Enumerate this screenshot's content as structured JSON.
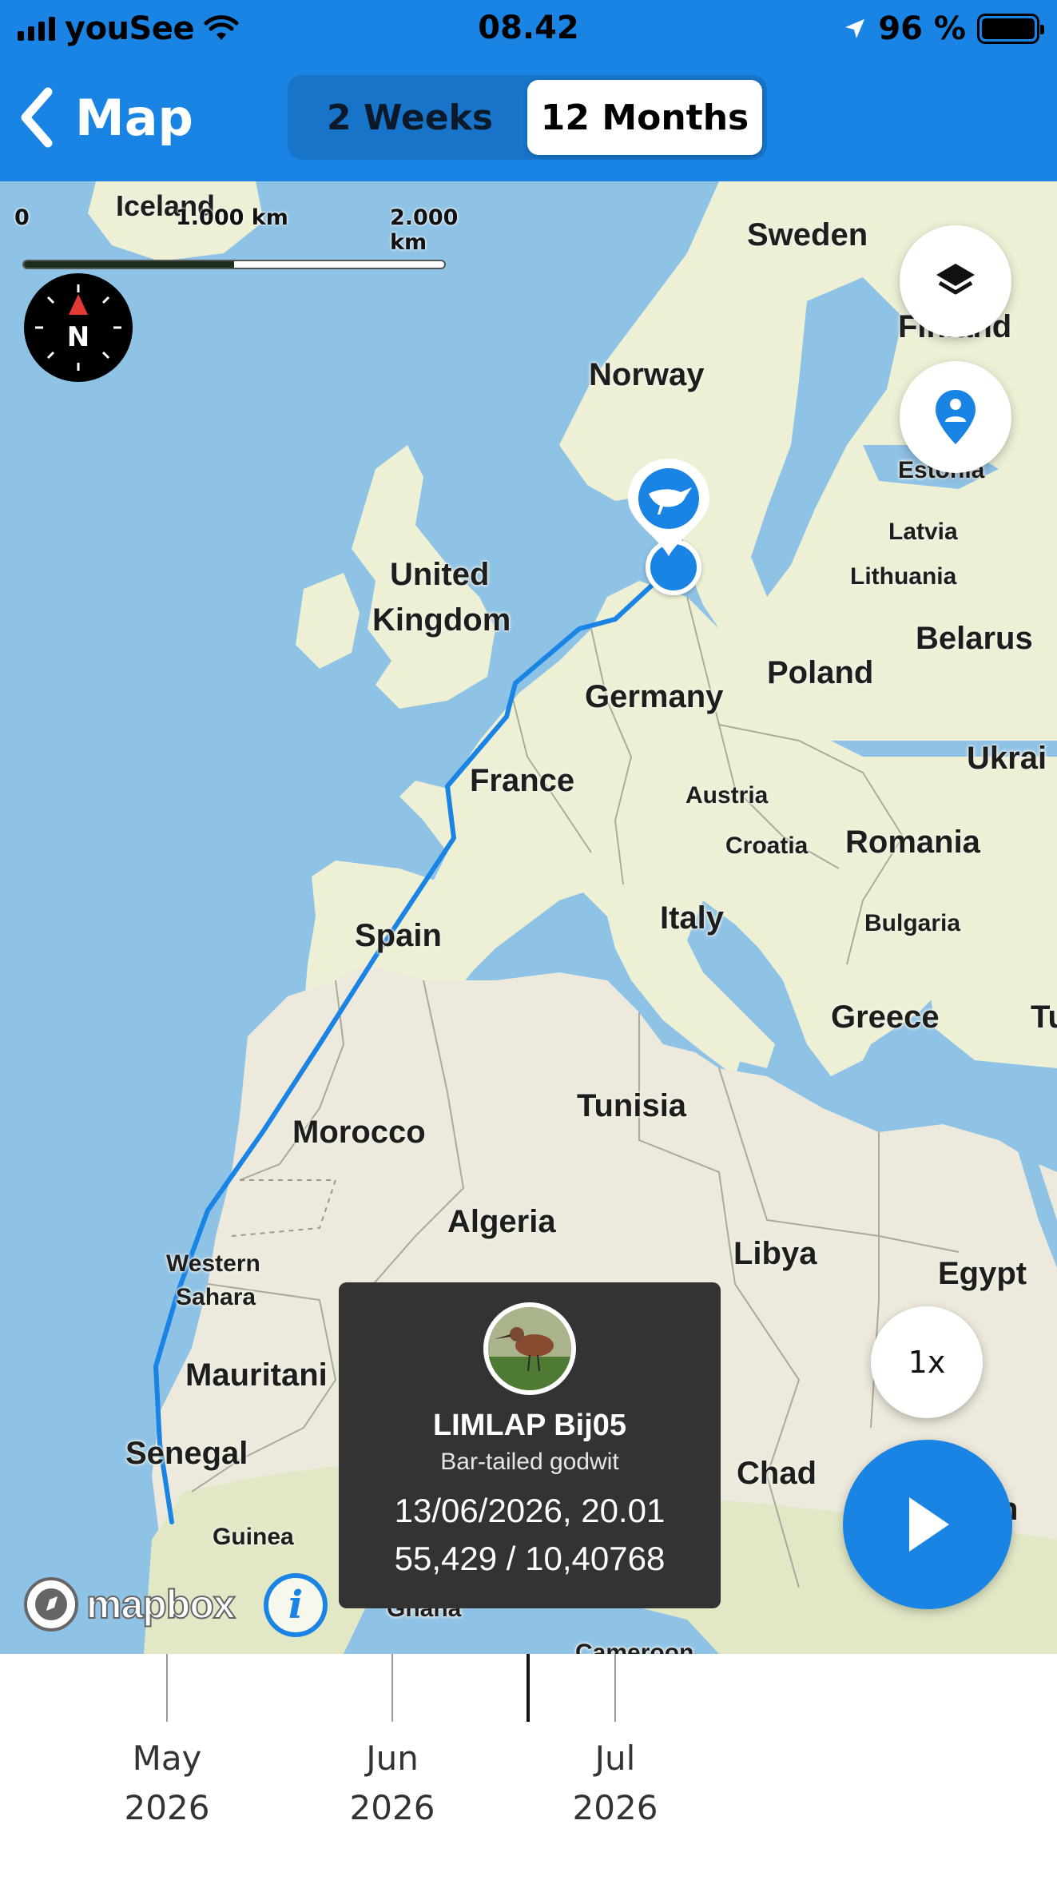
{
  "status_bar": {
    "carrier": "youSee",
    "time": "08.42",
    "battery": "96 %"
  },
  "nav": {
    "back_label": "Map",
    "segments": [
      "2 Weeks",
      "12 Months"
    ],
    "active_segment": "12 Months"
  },
  "map": {
    "scale": {
      "zero": "0",
      "mid": "1.000 km",
      "max": "2.000 km"
    },
    "compass_label": "N",
    "labels": {
      "iceland": "Iceland",
      "sweden": "Sweden",
      "finland": "Finland",
      "norway": "Norway",
      "estonia": "Estonia",
      "latvia": "Latvia",
      "lithuania": "Lithuania",
      "united_kingdom_1": "United",
      "united_kingdom_2": "Kingdom",
      "belarus": "Belarus",
      "poland": "Poland",
      "germany": "Germany",
      "ukraine": "Ukrai",
      "france": "France",
      "austria": "Austria",
      "croatia": "Croatia",
      "romania": "Romania",
      "bulgaria": "Bulgaria",
      "spain": "Spain",
      "italy": "Italy",
      "greece": "Greece",
      "turkey": "Tu",
      "tunisia": "Tunisia",
      "morocco": "Morocco",
      "algeria": "Algeria",
      "libya": "Libya",
      "egypt": "Egypt",
      "western_sahara_1": "Western",
      "western_sahara_2": "Sahara",
      "mauritania": "Mauritani",
      "senegal": "Senegal",
      "chad": "Chad",
      "guinea": "Guinea",
      "ghana": "Ghana",
      "sudan_fragment": "n",
      "cameroon_fragment": "Cameroon"
    },
    "speed_label": "1x",
    "mapbox_label": "mapbox",
    "info_label": "i"
  },
  "popup": {
    "name": "LIMLAP Bij05",
    "species": "Bar-tailed godwit",
    "datetime": "13/06/2026, 20.01",
    "coordinates": "55,429 / 10,40768"
  },
  "timeline": {
    "months": [
      {
        "month": "May",
        "year": "2026"
      },
      {
        "month": "Jun",
        "year": "2026"
      },
      {
        "month": "Jul",
        "year": "2026"
      }
    ]
  },
  "colors": {
    "accent": "#1a84e4",
    "water": "#8fc3e6",
    "land": "#eef0d6",
    "desert": "#ede9dc",
    "popup_bg": "#333333"
  },
  "icons": {
    "back": "chevron-left-icon",
    "layers": "layers-icon",
    "location": "person-pin-icon",
    "play": "play-icon",
    "bird": "bird-icon",
    "compass": "compass-icon",
    "info": "info-icon",
    "wifi": "wifi-icon",
    "signal": "signal-icon",
    "battery": "battery-icon",
    "location_arrow": "location-arrow-icon"
  }
}
